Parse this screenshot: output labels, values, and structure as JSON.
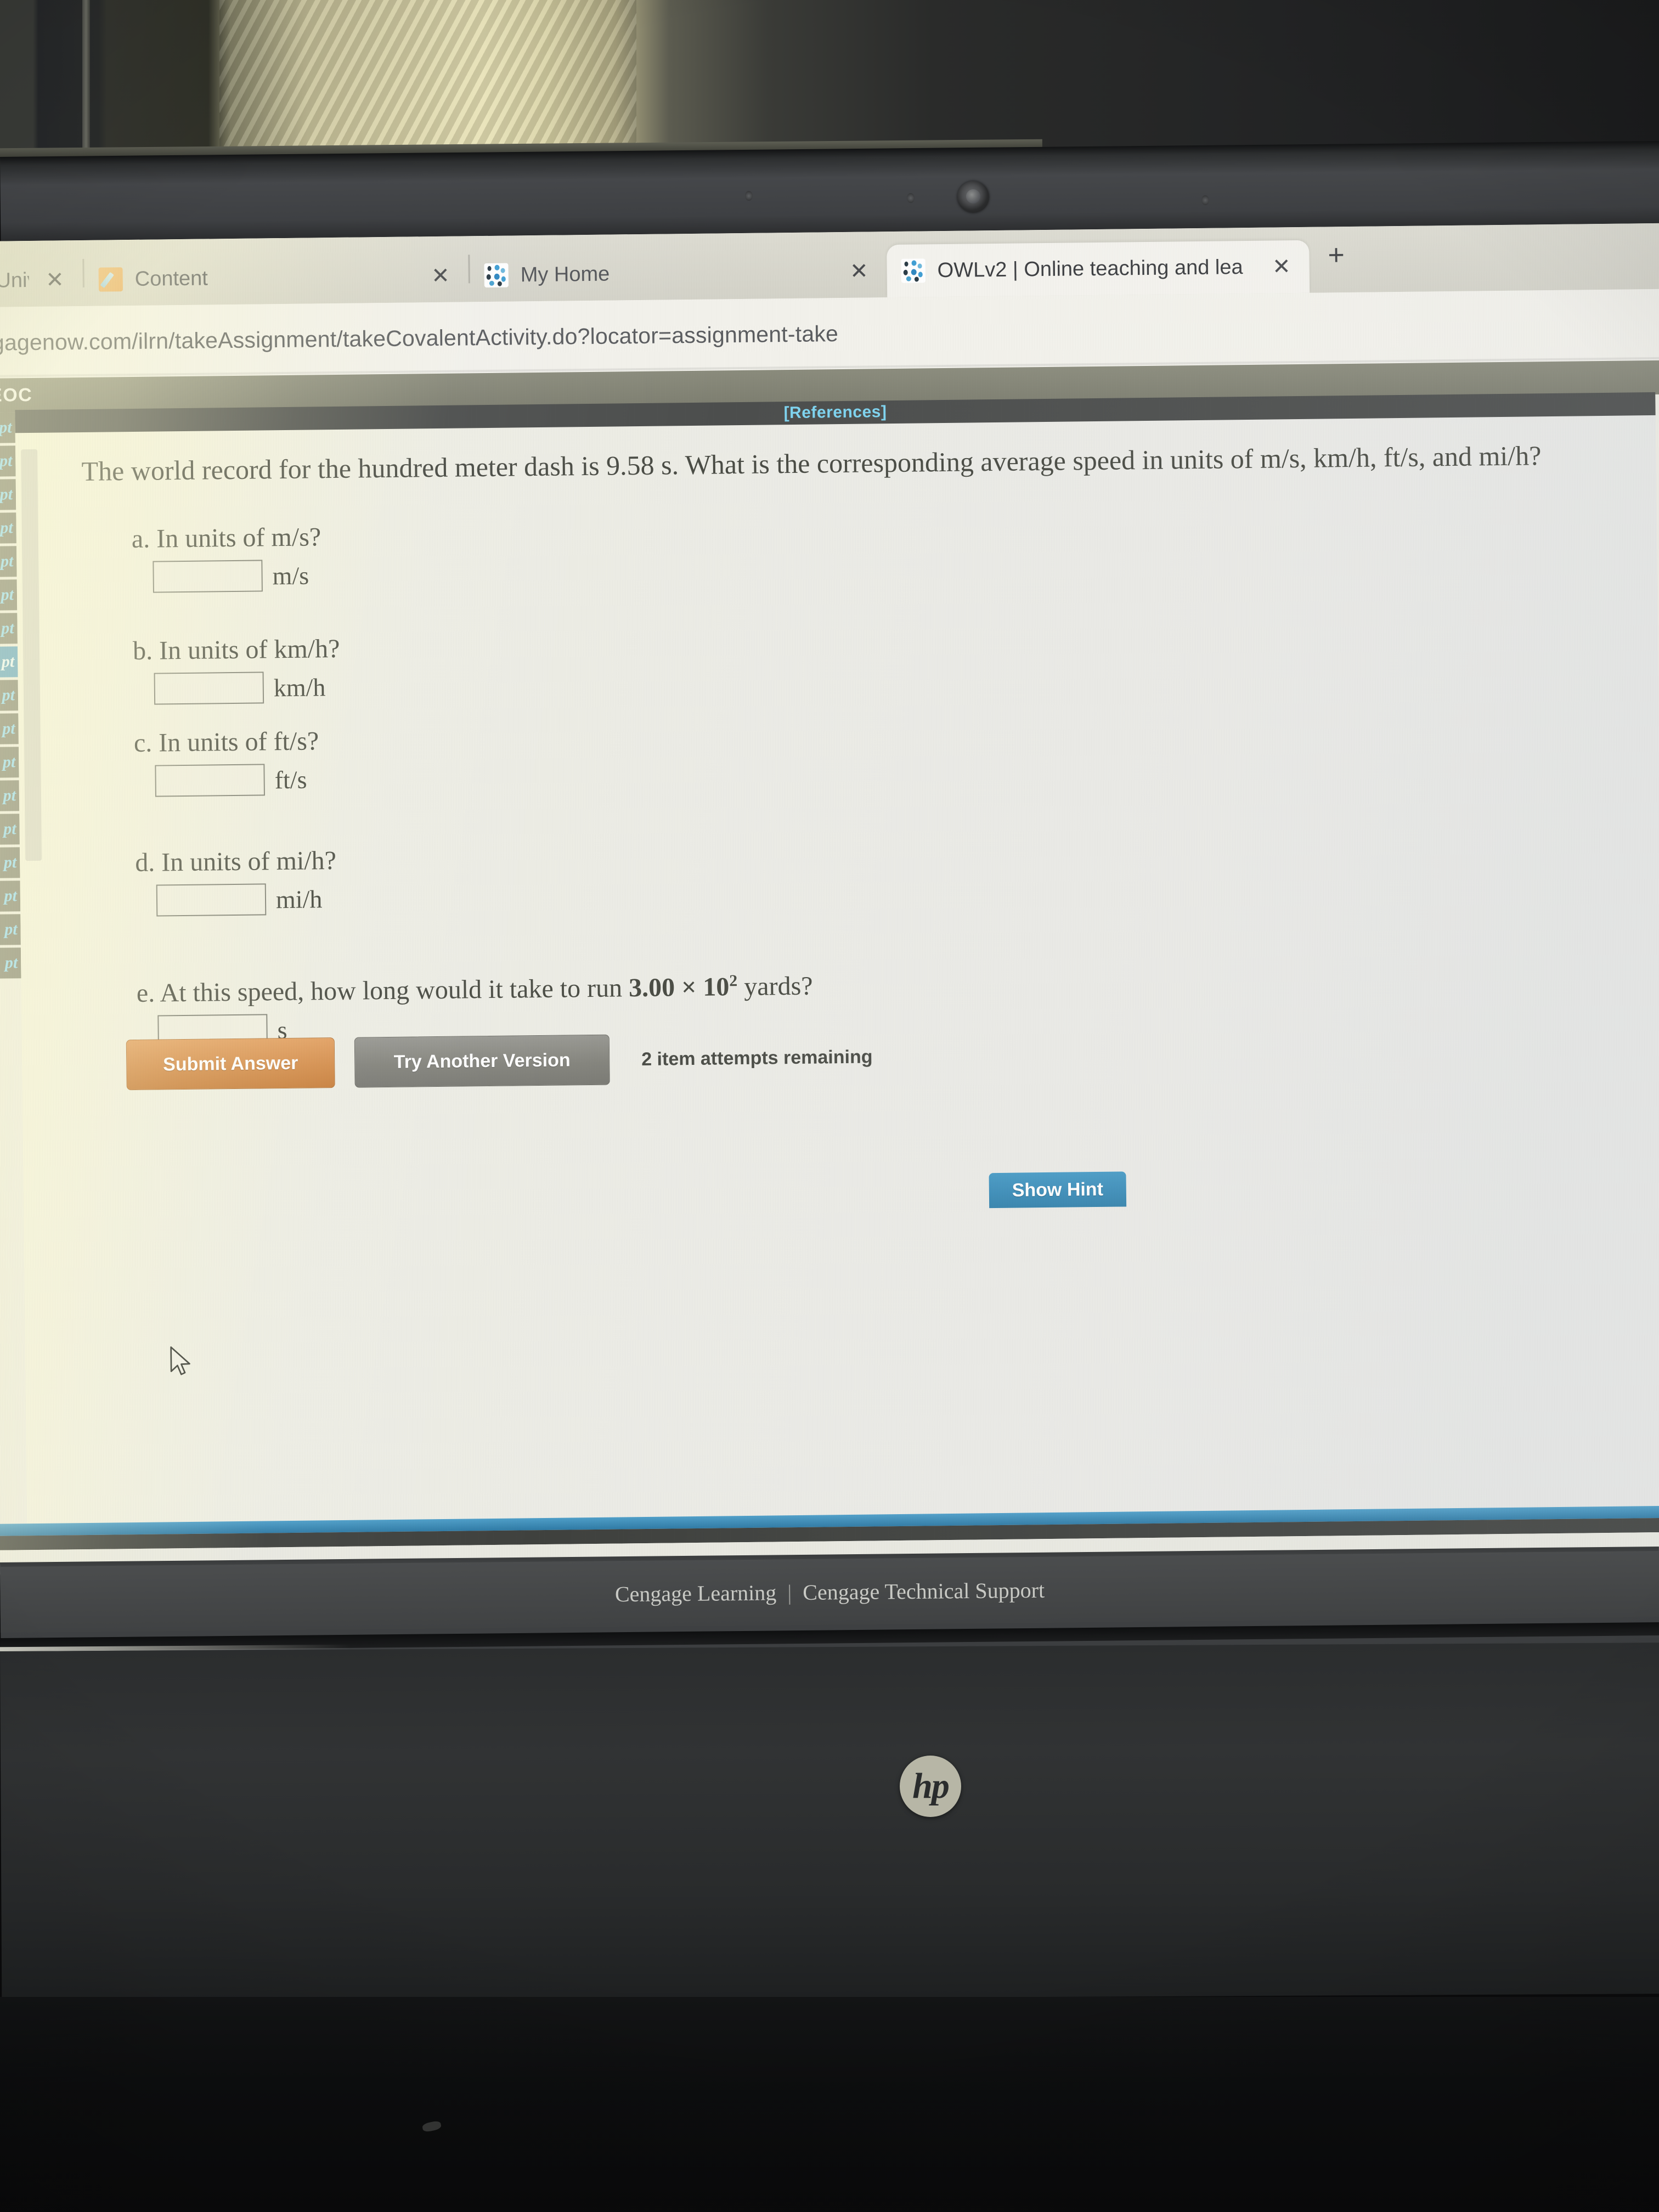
{
  "browser": {
    "tabs": [
      {
        "title": "e Univ",
        "favicon": "none-icon",
        "active": false
      },
      {
        "title": "Content",
        "favicon": "pencil-icon",
        "active": false
      },
      {
        "title": "My Home",
        "favicon": "owl-icon",
        "active": false
      },
      {
        "title": "OWLv2 | Online teaching and lea",
        "favicon": "owl-icon",
        "active": true
      }
    ],
    "close_label": "✕",
    "new_tab_label": "+",
    "url": "ngagenow.com/ilrn/takeAssignment/takeCovalentActivity.do?locator=assignment-take"
  },
  "page": {
    "header_label": "EOC",
    "references_link": "[References]",
    "sidebar_items": [
      {
        "label": "pt",
        "selected": false
      },
      {
        "label": "pt",
        "selected": false
      },
      {
        "label": "pt",
        "selected": false
      },
      {
        "label": "pt",
        "selected": false
      },
      {
        "label": "pt",
        "selected": false
      },
      {
        "label": "pt",
        "selected": false
      },
      {
        "label": "pt",
        "selected": false
      },
      {
        "label": "pt",
        "selected": true
      },
      {
        "label": "pt",
        "selected": false
      },
      {
        "label": "pt",
        "selected": false
      },
      {
        "label": "pt",
        "selected": false
      },
      {
        "label": "pt",
        "selected": false
      },
      {
        "label": "pt",
        "selected": false
      },
      {
        "label": "pt",
        "selected": false
      },
      {
        "label": "pt",
        "selected": false
      },
      {
        "label": "pt",
        "selected": false
      },
      {
        "label": "pt",
        "selected": false
      }
    ]
  },
  "question": {
    "stem": "The world record for the hundred meter dash is 9.58 s. What is the corresponding average speed in units of m/s, km/h, ft/s, and mi/h?",
    "parts": [
      {
        "id": "a",
        "prompt": "a. In units of m/s?",
        "value": "",
        "unit": "m/s"
      },
      {
        "id": "b",
        "prompt": "b. In units of km/h?",
        "value": "",
        "unit": "km/h"
      },
      {
        "id": "c",
        "prompt": "c. In units of ft/s?",
        "value": "",
        "unit": "ft/s"
      },
      {
        "id": "d",
        "prompt": "d. In units of mi/h?",
        "value": "",
        "unit": "mi/h"
      }
    ],
    "part_e": {
      "id": "e",
      "prompt_before": "e. At this speed, how long would it take to run ",
      "coefficient": "3.00",
      "times": "×",
      "base": "10",
      "exponent": "2",
      "prompt_after": "yards?",
      "value": "",
      "unit": "s"
    }
  },
  "actions": {
    "submit_label": "Submit Answer",
    "try_another_label": "Try Another Version",
    "attempts_text": "2 item attempts remaining",
    "show_hint_label": "Show Hint"
  },
  "footer": {
    "left_link": "Cengage Learning",
    "separator": "|",
    "right_link": "Cengage Technical Support"
  },
  "hardware": {
    "brand_logo": "hp"
  },
  "colors": {
    "submit_orange": "#d58f4e",
    "try_gray": "#86867f",
    "hint_blue": "#3d8db8",
    "sidebar_selected": "#5a9fc4",
    "reference_link": "#7fd4f0"
  }
}
